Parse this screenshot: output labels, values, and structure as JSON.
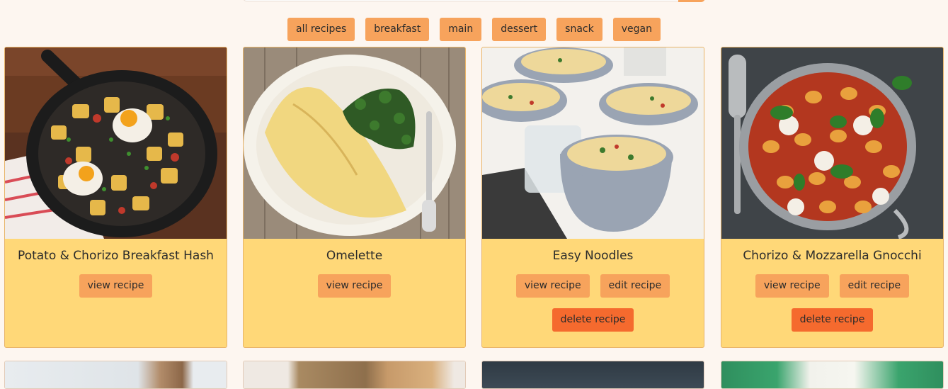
{
  "filters": [
    "all recipes",
    "breakfast",
    "main",
    "dessert",
    "snack",
    "vegan"
  ],
  "recipes": [
    {
      "title": "Potato & Chorizo Breakfast Hash",
      "view_label": "view recipe"
    },
    {
      "title": "Omelette",
      "view_label": "view recipe"
    },
    {
      "title": "Easy Noodles",
      "view_label": "view recipe",
      "edit_label": "edit recipe",
      "delete_label": "delete recipe"
    },
    {
      "title": "Chorizo & Mozzarella Gnocchi",
      "view_label": "view recipe",
      "edit_label": "edit recipe",
      "delete_label": "delete recipe"
    }
  ],
  "colors": {
    "background": "#fdf6f0",
    "card": "#ffd878",
    "button": "#f7a35c",
    "delete_button": "#f56a2e"
  }
}
